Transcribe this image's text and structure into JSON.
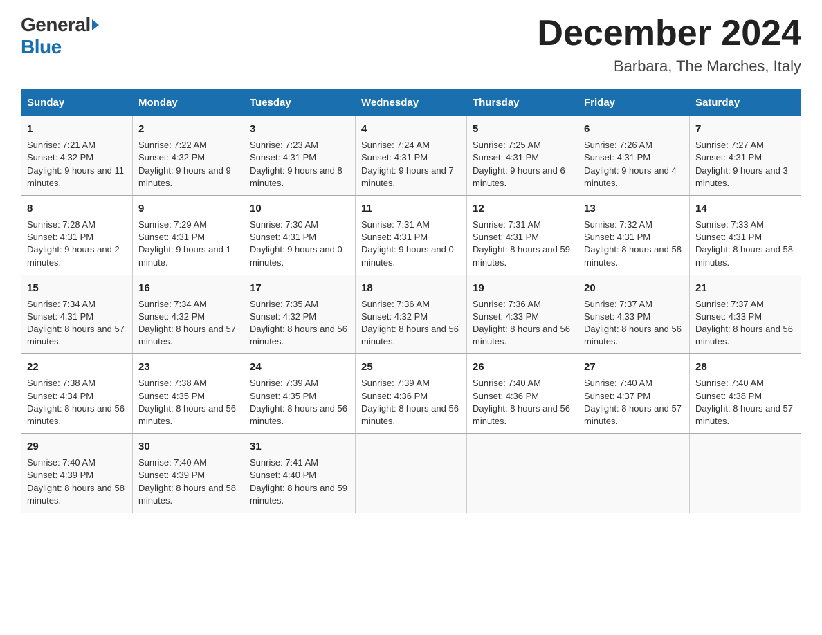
{
  "header": {
    "logo_general": "General",
    "logo_blue": "Blue",
    "main_title": "December 2024",
    "subtitle": "Barbara, The Marches, Italy"
  },
  "days_of_week": [
    "Sunday",
    "Monday",
    "Tuesday",
    "Wednesday",
    "Thursday",
    "Friday",
    "Saturday"
  ],
  "weeks": [
    [
      {
        "date": "1",
        "sunrise": "Sunrise: 7:21 AM",
        "sunset": "Sunset: 4:32 PM",
        "daylight": "Daylight: 9 hours and 11 minutes."
      },
      {
        "date": "2",
        "sunrise": "Sunrise: 7:22 AM",
        "sunset": "Sunset: 4:32 PM",
        "daylight": "Daylight: 9 hours and 9 minutes."
      },
      {
        "date": "3",
        "sunrise": "Sunrise: 7:23 AM",
        "sunset": "Sunset: 4:31 PM",
        "daylight": "Daylight: 9 hours and 8 minutes."
      },
      {
        "date": "4",
        "sunrise": "Sunrise: 7:24 AM",
        "sunset": "Sunset: 4:31 PM",
        "daylight": "Daylight: 9 hours and 7 minutes."
      },
      {
        "date": "5",
        "sunrise": "Sunrise: 7:25 AM",
        "sunset": "Sunset: 4:31 PM",
        "daylight": "Daylight: 9 hours and 6 minutes."
      },
      {
        "date": "6",
        "sunrise": "Sunrise: 7:26 AM",
        "sunset": "Sunset: 4:31 PM",
        "daylight": "Daylight: 9 hours and 4 minutes."
      },
      {
        "date": "7",
        "sunrise": "Sunrise: 7:27 AM",
        "sunset": "Sunset: 4:31 PM",
        "daylight": "Daylight: 9 hours and 3 minutes."
      }
    ],
    [
      {
        "date": "8",
        "sunrise": "Sunrise: 7:28 AM",
        "sunset": "Sunset: 4:31 PM",
        "daylight": "Daylight: 9 hours and 2 minutes."
      },
      {
        "date": "9",
        "sunrise": "Sunrise: 7:29 AM",
        "sunset": "Sunset: 4:31 PM",
        "daylight": "Daylight: 9 hours and 1 minute."
      },
      {
        "date": "10",
        "sunrise": "Sunrise: 7:30 AM",
        "sunset": "Sunset: 4:31 PM",
        "daylight": "Daylight: 9 hours and 0 minutes."
      },
      {
        "date": "11",
        "sunrise": "Sunrise: 7:31 AM",
        "sunset": "Sunset: 4:31 PM",
        "daylight": "Daylight: 9 hours and 0 minutes."
      },
      {
        "date": "12",
        "sunrise": "Sunrise: 7:31 AM",
        "sunset": "Sunset: 4:31 PM",
        "daylight": "Daylight: 8 hours and 59 minutes."
      },
      {
        "date": "13",
        "sunrise": "Sunrise: 7:32 AM",
        "sunset": "Sunset: 4:31 PM",
        "daylight": "Daylight: 8 hours and 58 minutes."
      },
      {
        "date": "14",
        "sunrise": "Sunrise: 7:33 AM",
        "sunset": "Sunset: 4:31 PM",
        "daylight": "Daylight: 8 hours and 58 minutes."
      }
    ],
    [
      {
        "date": "15",
        "sunrise": "Sunrise: 7:34 AM",
        "sunset": "Sunset: 4:31 PM",
        "daylight": "Daylight: 8 hours and 57 minutes."
      },
      {
        "date": "16",
        "sunrise": "Sunrise: 7:34 AM",
        "sunset": "Sunset: 4:32 PM",
        "daylight": "Daylight: 8 hours and 57 minutes."
      },
      {
        "date": "17",
        "sunrise": "Sunrise: 7:35 AM",
        "sunset": "Sunset: 4:32 PM",
        "daylight": "Daylight: 8 hours and 56 minutes."
      },
      {
        "date": "18",
        "sunrise": "Sunrise: 7:36 AM",
        "sunset": "Sunset: 4:32 PM",
        "daylight": "Daylight: 8 hours and 56 minutes."
      },
      {
        "date": "19",
        "sunrise": "Sunrise: 7:36 AM",
        "sunset": "Sunset: 4:33 PM",
        "daylight": "Daylight: 8 hours and 56 minutes."
      },
      {
        "date": "20",
        "sunrise": "Sunrise: 7:37 AM",
        "sunset": "Sunset: 4:33 PM",
        "daylight": "Daylight: 8 hours and 56 minutes."
      },
      {
        "date": "21",
        "sunrise": "Sunrise: 7:37 AM",
        "sunset": "Sunset: 4:33 PM",
        "daylight": "Daylight: 8 hours and 56 minutes."
      }
    ],
    [
      {
        "date": "22",
        "sunrise": "Sunrise: 7:38 AM",
        "sunset": "Sunset: 4:34 PM",
        "daylight": "Daylight: 8 hours and 56 minutes."
      },
      {
        "date": "23",
        "sunrise": "Sunrise: 7:38 AM",
        "sunset": "Sunset: 4:35 PM",
        "daylight": "Daylight: 8 hours and 56 minutes."
      },
      {
        "date": "24",
        "sunrise": "Sunrise: 7:39 AM",
        "sunset": "Sunset: 4:35 PM",
        "daylight": "Daylight: 8 hours and 56 minutes."
      },
      {
        "date": "25",
        "sunrise": "Sunrise: 7:39 AM",
        "sunset": "Sunset: 4:36 PM",
        "daylight": "Daylight: 8 hours and 56 minutes."
      },
      {
        "date": "26",
        "sunrise": "Sunrise: 7:40 AM",
        "sunset": "Sunset: 4:36 PM",
        "daylight": "Daylight: 8 hours and 56 minutes."
      },
      {
        "date": "27",
        "sunrise": "Sunrise: 7:40 AM",
        "sunset": "Sunset: 4:37 PM",
        "daylight": "Daylight: 8 hours and 57 minutes."
      },
      {
        "date": "28",
        "sunrise": "Sunrise: 7:40 AM",
        "sunset": "Sunset: 4:38 PM",
        "daylight": "Daylight: 8 hours and 57 minutes."
      }
    ],
    [
      {
        "date": "29",
        "sunrise": "Sunrise: 7:40 AM",
        "sunset": "Sunset: 4:39 PM",
        "daylight": "Daylight: 8 hours and 58 minutes."
      },
      {
        "date": "30",
        "sunrise": "Sunrise: 7:40 AM",
        "sunset": "Sunset: 4:39 PM",
        "daylight": "Daylight: 8 hours and 58 minutes."
      },
      {
        "date": "31",
        "sunrise": "Sunrise: 7:41 AM",
        "sunset": "Sunset: 4:40 PM",
        "daylight": "Daylight: 8 hours and 59 minutes."
      },
      null,
      null,
      null,
      null
    ]
  ]
}
